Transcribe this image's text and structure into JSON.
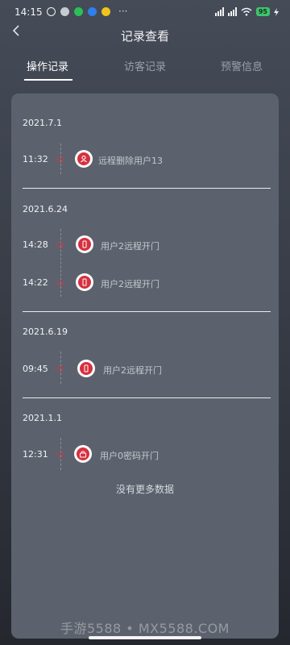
{
  "status_bar": {
    "time": "14:15",
    "dots": "···",
    "battery": "95",
    "left_icons": [
      "alarm-icon",
      "cloud-icon",
      "chat-icon",
      "video-icon",
      "app-icon"
    ],
    "right_icons": [
      "signal-icon",
      "signal-icon",
      "wifi-icon",
      "battery-icon",
      "charging-icon"
    ]
  },
  "header": {
    "title": "记录查看",
    "back_icon": "chevron-left-icon"
  },
  "tabs": [
    {
      "label": "操作记录",
      "active": true
    },
    {
      "label": "访客记录",
      "active": false
    },
    {
      "label": "预警信息",
      "active": false
    }
  ],
  "records": [
    {
      "date": "2021.7.1",
      "items": [
        {
          "time": "11:32",
          "text": "远程删除用户13",
          "icon": "user-delete-icon"
        }
      ]
    },
    {
      "date": "2021.6.24",
      "items": [
        {
          "time": "14:28",
          "text": "用户2远程开门",
          "icon": "phone-icon"
        },
        {
          "time": "14:22",
          "text": "用户2远程开门",
          "icon": "phone-icon"
        }
      ]
    },
    {
      "date": "2021.6.19",
      "items": [
        {
          "time": "09:45",
          "text": "用户2远程开门",
          "icon": "phone-icon"
        }
      ]
    },
    {
      "date": "2021.1.1",
      "items": [
        {
          "time": "12:31",
          "text": "用户0密码开门",
          "icon": "keypad-icon"
        }
      ]
    }
  ],
  "footer": {
    "no_more": "没有更多数据"
  },
  "watermark": "手游5588 • MX5588.COM",
  "colors": {
    "accent": "#d6303f",
    "card": "#5c626d"
  }
}
